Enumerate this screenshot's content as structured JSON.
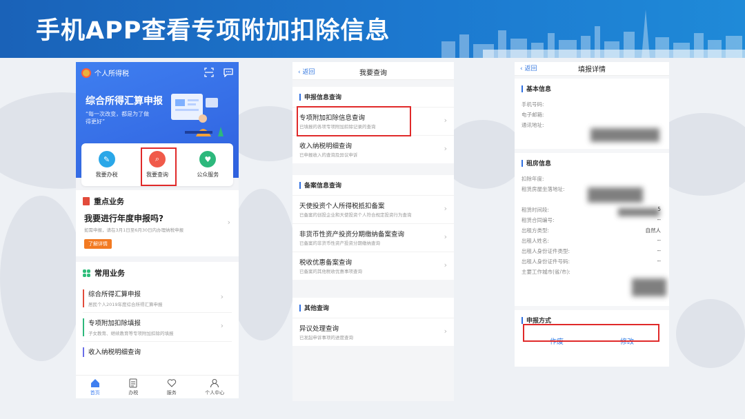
{
  "banner": {
    "title": "手机APP查看专项附加扣除信息"
  },
  "phone1": {
    "app_name": "个人所得税",
    "hero_title": "综合所得汇算申报",
    "hero_subtitle": "“每一次改变，都是为了做得更好”",
    "quick": [
      {
        "label": "我要办税",
        "icon": "pen-icon",
        "color": "#2aa7e8"
      },
      {
        "label": "我要查询",
        "icon": "search-icon",
        "color": "#f05a4a"
      },
      {
        "label": "公众服务",
        "icon": "service-icon",
        "color": "#2db87c"
      }
    ],
    "key_section": "重点业务",
    "key_title": "我要进行年度申报吗?",
    "key_desc": "如需申报，请在3月1日至6月30日内办理纳税申报",
    "key_btn": "了解详情",
    "common_section": "常用业务",
    "common_items": [
      {
        "title": "综合所得汇算申报",
        "desc": "居民个人2019年度综合所得汇算申报",
        "color": "#e24b3b"
      },
      {
        "title": "专项附加扣除填报",
        "desc": "子女教育、继续教育等专项附加扣除的填报",
        "color": "#2db87c"
      },
      {
        "title": "收入纳税明细查询",
        "desc": "",
        "color": "#6a6ee8"
      }
    ],
    "tabs": [
      "首页",
      "办税",
      "服务",
      "个人中心"
    ]
  },
  "phone2": {
    "back": "返回",
    "title": "我要查询",
    "groups": [
      {
        "head": "申报信息查询",
        "rows": [
          {
            "title": "专项附加扣除信息查询",
            "desc": "已填报的各项专项附加扣除记录的查询"
          },
          {
            "title": "收入纳税明细查询",
            "desc": "已申报收入的查询及异议申诉"
          }
        ]
      },
      {
        "head": "备案信息查询",
        "rows": [
          {
            "title": "天使投资个人所得税抵扣备案",
            "desc": "已备案的创投企业和天使投资个人符合规定投资行为查询"
          },
          {
            "title": "非货币性资产投资分期缴纳备案查询",
            "desc": "已备案的非货币性资产投资分期缴纳查询"
          },
          {
            "title": "税收优惠备案查询",
            "desc": "已备案的其他税收优惠事项查询"
          }
        ]
      },
      {
        "head": "其他查询",
        "rows": [
          {
            "title": "异议处理查询",
            "desc": "已发起申诉事项的进度查询"
          }
        ]
      }
    ]
  },
  "phone3": {
    "back": "返回",
    "title": "填报详情",
    "basic_head": "基本信息",
    "basic": [
      {
        "k": "手机号码:",
        "v": ""
      },
      {
        "k": "电子邮箱:",
        "v": ""
      },
      {
        "k": "通讯地址:",
        "v": ""
      }
    ],
    "rent_head": "租房信息",
    "rent": [
      {
        "k": "扣除年度:",
        "v": ""
      },
      {
        "k": "租赁房屋坐落地址:",
        "v": ""
      },
      {
        "k": "租赁时间段:",
        "v": "5"
      },
      {
        "k": "租赁合同编号:",
        "v": "--"
      },
      {
        "k": "出租方类型:",
        "v": "自然人"
      },
      {
        "k": "出租人姓名:",
        "v": "--"
      },
      {
        "k": "出租人身份证件类型:",
        "v": "--"
      },
      {
        "k": "出租人身份证件号码:",
        "v": "--"
      },
      {
        "k": "主要工作城市(省/市):",
        "v": ""
      }
    ],
    "method_head": "申报方式",
    "btn_void": "作废",
    "btn_edit": "修改"
  }
}
